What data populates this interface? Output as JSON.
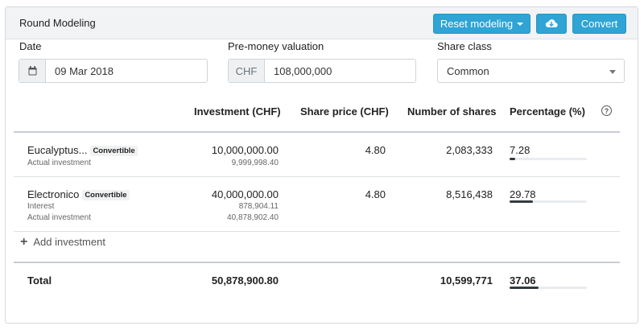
{
  "header": {
    "title": "Round Modeling",
    "reset_label": "Reset modeling",
    "convert_label": "Convert",
    "cloud_icon": "cloud-download-icon"
  },
  "form": {
    "date_label": "Date",
    "date_value": "09 Mar 2018",
    "valuation_label": "Pre-money valuation",
    "valuation_currency": "CHF",
    "valuation_value": "108,000,000",
    "share_class_label": "Share class",
    "share_class_value": "Common"
  },
  "table": {
    "headers": {
      "investment": "Investment (CHF)",
      "share_price": "Share price (CHF)",
      "shares": "Number of shares",
      "percentage": "Percentage (%)",
      "help": "?"
    },
    "rows": [
      {
        "name": "Eucalyptus...",
        "badge": "Convertible",
        "sub1": "Actual investment",
        "investment": "10,000,000.00",
        "inv_sub1": "9,999,998.40",
        "share_price": "4.80",
        "shares": "2,083,333",
        "percentage": "7.28",
        "pct_value": 7.28
      },
      {
        "name": "Electronico",
        "badge": "Convertible",
        "sub1": "Interest",
        "sub2": "Actual investment",
        "investment": "40,000,000.00",
        "inv_sub1": "878,904.11",
        "inv_sub2": "40,878,902.40",
        "share_price": "4.80",
        "shares": "8,516,438",
        "percentage": "29.78",
        "pct_value": 29.78
      }
    ],
    "add_label": "Add investment",
    "total": {
      "label": "Total",
      "investment": "50,878,900.80",
      "shares": "10,599,771",
      "percentage": "37.06",
      "pct_value": 37.06
    }
  }
}
